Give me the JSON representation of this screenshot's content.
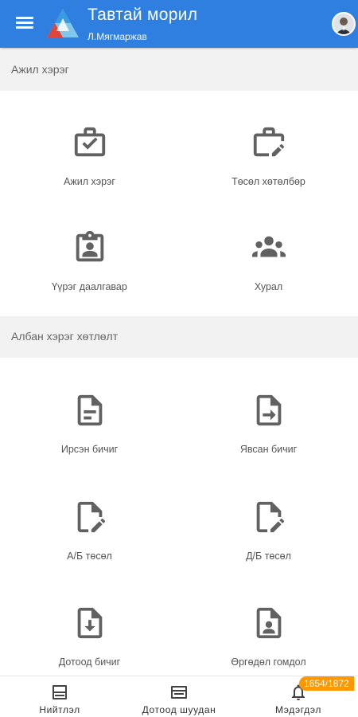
{
  "appbar": {
    "title": "Тавтай морил",
    "user": "Л.Мягмаржав",
    "menu_icon": "menu-icon",
    "logo": "app-logo",
    "brand_color": "#2f7fe0"
  },
  "sections": [
    {
      "title": "Ажил хэрэг",
      "tiles": [
        {
          "label": "Ажил хэрэг",
          "icon": "briefcase-check-icon"
        },
        {
          "label": "Төсөл хөтөлбөр",
          "icon": "briefcase-edit-icon"
        },
        {
          "label": "Үүрэг даалгавар",
          "icon": "clipboard-account-icon"
        },
        {
          "label": "Хурал",
          "icon": "group-icon"
        }
      ]
    },
    {
      "title": "Албан хэрэг хөтлөлт",
      "tiles": [
        {
          "label": "Ирсэн бичиг",
          "icon": "file-document-icon"
        },
        {
          "label": "Явсан бичиг",
          "icon": "file-send-icon"
        },
        {
          "label": "А/Б төсөл",
          "icon": "file-edit-icon"
        },
        {
          "label": "Д/Б төсөл",
          "icon": "file-edit-icon"
        },
        {
          "label": "Дотоод бичиг",
          "icon": "file-download-icon"
        },
        {
          "label": "Өргөдөл гомдол",
          "icon": "file-account-icon"
        }
      ]
    }
  ],
  "bottom_nav": [
    {
      "label": "Нийтлэл",
      "icon": "article-icon"
    },
    {
      "label": "Дотоод шуудан",
      "icon": "mailbox-icon"
    },
    {
      "label": "Мэдэгдэл",
      "icon": "bell-icon"
    }
  ],
  "notification_badge": "1654/1872",
  "badge_color": "#ff9800"
}
